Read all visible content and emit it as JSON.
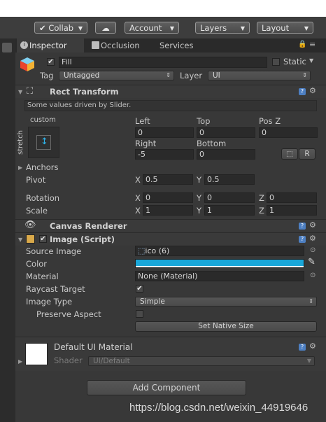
{
  "toolbar": {
    "collab_label": "Collab",
    "account_label": "Account",
    "layers_label": "Layers",
    "layout_label": "Layout"
  },
  "tabs": [
    {
      "label": "Inspector",
      "icon": "info-icon"
    },
    {
      "label": "Occlusion",
      "icon": "occlusion-icon"
    },
    {
      "label": "Services"
    }
  ],
  "object": {
    "name": "Fill",
    "active": true,
    "static_label": "Static",
    "tag_label": "Tag",
    "tag_value": "Untagged",
    "layer_label": "Layer",
    "layer_value": "UI"
  },
  "rect_transform": {
    "title": "Rect Transform",
    "notice": "Some values driven by Slider.",
    "anchor_preset": {
      "top_label": "custom",
      "side_label": "stretch"
    },
    "headers_row1": [
      "Left",
      "Top",
      "Pos Z"
    ],
    "values_row1": [
      "0",
      "0",
      "0"
    ],
    "headers_row2": [
      "Right",
      "Bottom"
    ],
    "values_row2": [
      "-5",
      "0"
    ],
    "blueprint_btn": "⬚",
    "raw_btn": "R",
    "anchors_label": "Anchors",
    "pivot_label": "Pivot",
    "pivot": {
      "x": "0.5",
      "y": "0.5"
    },
    "rotation_label": "Rotation",
    "rotation": {
      "x": "0",
      "y": "0",
      "z": "0"
    },
    "scale_label": "Scale",
    "scale": {
      "x": "1",
      "y": "1",
      "z": "1"
    },
    "axis": {
      "x": "X",
      "y": "Y",
      "z": "Z"
    }
  },
  "canvas_renderer": {
    "title": "Canvas Renderer"
  },
  "image": {
    "title": "Image (Script)",
    "enabled": true,
    "source_image_label": "Source Image",
    "source_image_value": "ico (6)",
    "color_label": "Color",
    "color_value": "#1aa7d9",
    "material_label": "Material",
    "material_value": "None (Material)",
    "raycast_label": "Raycast Target",
    "raycast_checked": true,
    "image_type_label": "Image Type",
    "image_type_value": "Simple",
    "preserve_label": "Preserve Aspect",
    "preserve_checked": false,
    "native_size_btn": "Set Native Size"
  },
  "material_preview": {
    "title": "Default UI Material",
    "shader_label": "Shader",
    "shader_value": "UI/Default"
  },
  "add_component_label": "Add Component",
  "watermark": "https://blog.csdn.net/weixin_44919646"
}
